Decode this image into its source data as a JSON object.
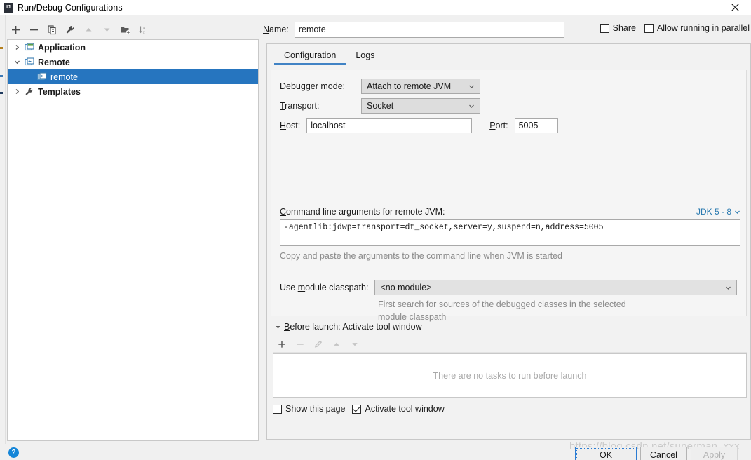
{
  "window": {
    "title": "Run/Debug Configurations",
    "app_icon": "intellij-idea-icon",
    "close_label": "×"
  },
  "left_toolbar": {
    "buttons": [
      {
        "name": "add-configuration-button",
        "icon": "plus-icon",
        "enabled": true
      },
      {
        "name": "remove-configuration-button",
        "icon": "minus-icon",
        "enabled": true
      },
      {
        "name": "copy-configuration-button",
        "icon": "copy-icon",
        "enabled": true
      },
      {
        "name": "edit-templates-button",
        "icon": "wrench-icon",
        "enabled": true
      },
      {
        "name": "move-up-button",
        "icon": "arrow-up-icon",
        "enabled": false
      },
      {
        "name": "move-down-button",
        "icon": "arrow-down-icon",
        "enabled": false
      },
      {
        "name": "create-folder-button",
        "icon": "folder-add-icon",
        "enabled": true
      },
      {
        "name": "sort-configurations-button",
        "icon": "sort-az-icon",
        "enabled": true
      }
    ]
  },
  "tree": {
    "items": [
      {
        "label": "Application",
        "icon": "application-icon",
        "arrow": "chevron-right-icon",
        "indent": 0,
        "expanded": false,
        "selected": false,
        "bold": true
      },
      {
        "label": "Remote",
        "icon": "remote-icon",
        "arrow": "chevron-down-icon",
        "indent": 0,
        "expanded": true,
        "selected": false,
        "bold": true
      },
      {
        "label": "remote",
        "icon": "remote-config-icon",
        "arrow": "",
        "indent": 1,
        "expanded": false,
        "selected": true,
        "bold": false
      },
      {
        "label": "Templates",
        "icon": "wrench-icon",
        "arrow": "chevron-right-icon",
        "indent": 0,
        "expanded": false,
        "selected": false,
        "bold": true
      }
    ]
  },
  "header": {
    "name_label": "Name:",
    "name_mnemonic": "N",
    "name_value": "remote",
    "name_placeholder": "",
    "share_label": "Share",
    "share_mnemonic": "S",
    "share_checked": false,
    "parallel_label_pre": "Allow running in ",
    "parallel_mnemonic": "p",
    "parallel_label_post": "arallel",
    "parallel_checked": false
  },
  "tabs": [
    {
      "label": "Configuration",
      "active": true,
      "name": "tab-configuration"
    },
    {
      "label": "Logs",
      "active": false,
      "name": "tab-logs"
    }
  ],
  "configuration": {
    "debugger_mode_label_pre": "",
    "debugger_mode_mnemonic": "D",
    "debugger_mode_label": "ebugger mode:",
    "debugger_mode_value": "Attach to remote JVM",
    "transport_mnemonic": "T",
    "transport_label": "ransport:",
    "transport_value": "Socket",
    "host_mnemonic": "H",
    "host_label": "ost:",
    "host_value": "localhost",
    "port_mnemonic": "P",
    "port_label": "ort:",
    "port_value": "5005",
    "cmd_mnemonic": "C",
    "cmd_label": "ommand line arguments for remote JVM:",
    "jdk_link": "JDK 5 - 8",
    "cmd_value": "-agentlib:jdwp=transport=dt_socket,server=y,suspend=n,address=5005",
    "cmd_hint": "Copy and paste the arguments to the command line when JVM is started",
    "classpath_label_pre": "Use ",
    "classpath_mnemonic": "m",
    "classpath_label_post": "odule classpath:",
    "classpath_value": "<no module>",
    "classpath_hint_line1": "First search for sources of the debugged classes in the selected",
    "classpath_hint_line2": "module classpath"
  },
  "before_launch": {
    "mnemonic": "B",
    "title": "efore launch: Activate tool window",
    "toolbar": [
      {
        "name": "add-task-button",
        "icon": "plus-icon",
        "enabled": true
      },
      {
        "name": "remove-task-button",
        "icon": "minus-icon",
        "enabled": false
      },
      {
        "name": "edit-task-button",
        "icon": "pencil-icon",
        "enabled": false
      },
      {
        "name": "move-task-up-button",
        "icon": "arrow-up-icon",
        "enabled": false
      },
      {
        "name": "move-task-down-button",
        "icon": "arrow-down-icon",
        "enabled": false
      }
    ],
    "empty_message": "There are no tasks to run before launch",
    "show_page_label": "Show this page",
    "show_page_checked": false,
    "activate_window_label": "Activate tool window",
    "activate_window_checked": true
  },
  "footer": {
    "help_label": "?",
    "ok_label": "OK",
    "cancel_label": "Cancel",
    "apply_label": "Apply",
    "apply_enabled": false
  },
  "watermark": "https://blog.csdn.net/superman_xxx",
  "colors": {
    "selection_blue": "#2675bf",
    "tab_underline": "#4082c4",
    "link_blue": "#2a7ab0",
    "help_blue": "#1586d8",
    "primary_button_border": "#2b7cd3"
  }
}
